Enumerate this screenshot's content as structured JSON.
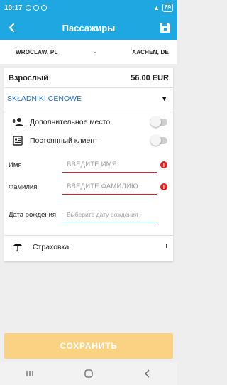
{
  "status_bar": {
    "time": "10:17",
    "battery": "69"
  },
  "header": {
    "title": "Пассажиры",
    "back_icon": "arrow-left-icon",
    "save_icon": "floppy-disk-icon"
  },
  "route": {
    "from": "WROCLAW, PL",
    "separator": "-",
    "to": "AACHEN, DE"
  },
  "passenger": {
    "type": "Взрослый",
    "price": "56.00 EUR",
    "price_components_label": "SKŁADNIKI CENOWE",
    "options": [
      {
        "label": "Дополнительное место",
        "icon": "add-person-icon",
        "enabled": false
      },
      {
        "label": "Постоянный клиент",
        "icon": "id-card-icon",
        "enabled": false
      }
    ],
    "fields": {
      "first_name": {
        "label": "Имя",
        "placeholder": "ВВЕДИТЕ ИМЯ",
        "value": ""
      },
      "last_name": {
        "label": "Фамилия",
        "placeholder": "ВВЕДИТЕ ФАМИЛИЮ",
        "value": ""
      },
      "birth_date": {
        "label": "Дата рождения",
        "placeholder": "Выберите дату рождения",
        "value": ""
      }
    },
    "insurance_label": "Страховка"
  },
  "actions": {
    "save_label": "СОХРАНИТЬ"
  },
  "error_mark": "!",
  "colors": {
    "primary": "#1ea7e1",
    "error": "#e02222",
    "save_button": "#fbd183",
    "link": "#1e6fbf"
  }
}
